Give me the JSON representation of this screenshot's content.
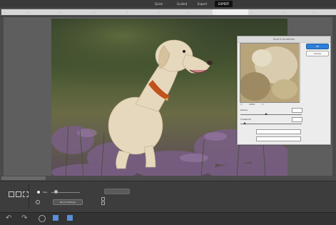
{
  "app": {
    "modes": [
      {
        "label": "Quick",
        "active": false
      },
      {
        "label": "Guided",
        "active": false
      },
      {
        "label": "Expert",
        "active": true
      }
    ]
  },
  "tabs": [
    "...",
    "...",
    "...",
    "...",
    "...",
    "...",
    "...",
    "...",
    "...",
    "...",
    "..."
  ],
  "document": {
    "title": "Dust & Scratches"
  },
  "dialog": {
    "title": "Dust & Scratches",
    "ok_label": "OK",
    "cancel_label": "Cancel",
    "zoom_label": "100%",
    "radius_label": "Radius",
    "radius_value": "",
    "threshold_label": "Threshold",
    "threshold_value": "",
    "field1_label": "",
    "field1_value": "",
    "field2_label": "",
    "field2_value": ""
  },
  "bottom": {
    "zoom_readout": "",
    "size_label": "Size",
    "brush_settings_label": "Brush Settings",
    "option_button_label": "",
    "checkbox1_label": "",
    "checkbox2_label": ""
  },
  "colors": {
    "accent": "#2e7fd9",
    "active_mode": "#111111",
    "panel_bg": "#3d3d3d",
    "canvas_bg": "#5e5e5e"
  }
}
